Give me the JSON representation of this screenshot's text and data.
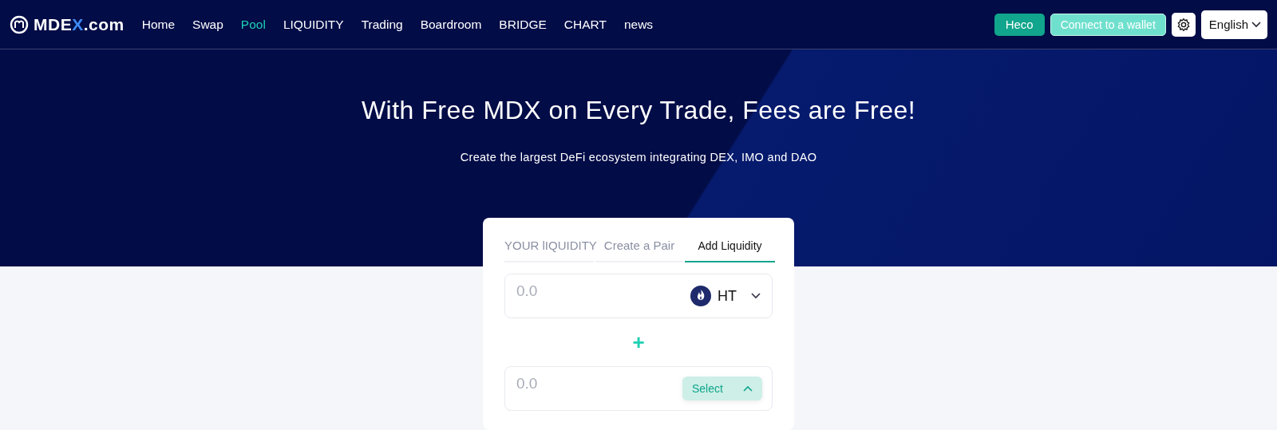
{
  "brand": {
    "parts": [
      {
        "text": "MDE",
        "accent": false
      },
      {
        "text": "X",
        "accent": true
      },
      {
        "text": ".com",
        "accent": false
      }
    ]
  },
  "nav": [
    {
      "label": "Home",
      "selected": false
    },
    {
      "label": "Swap",
      "selected": false
    },
    {
      "label": "Pool",
      "selected": true
    },
    {
      "label": "LIQUIDITY",
      "selected": false
    },
    {
      "label": "Trading",
      "selected": false
    },
    {
      "label": "Boardroom",
      "selected": false
    },
    {
      "label": "BRIDGE",
      "selected": false
    },
    {
      "label": "CHART",
      "selected": false
    },
    {
      "label": "news",
      "selected": false
    }
  ],
  "actions": {
    "network": "Heco",
    "connect": "Connect to a wallet",
    "language": "English"
  },
  "hero": {
    "title": "With Free MDX on Every Trade, Fees are Free!",
    "subtitle": "Create the largest DeFi ecosystem integrating DEX, IMO and DAO"
  },
  "card": {
    "tabs": [
      {
        "label": "YOUR lIQUIDITY",
        "selected": false
      },
      {
        "label": "Create a Pair",
        "selected": false
      },
      {
        "label": "Add Liquidity",
        "selected": true
      }
    ],
    "inputs": [
      {
        "placeholder": "0.0",
        "kind": "token",
        "token": "HT",
        "expanded": false
      },
      {
        "placeholder": "0.0",
        "kind": "select",
        "token": "Select",
        "expanded": true
      }
    ],
    "separator": "+"
  }
}
